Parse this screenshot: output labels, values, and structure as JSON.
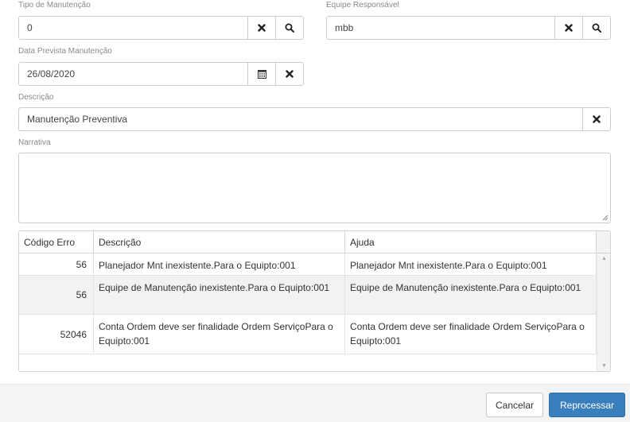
{
  "tipo_manutencao": {
    "label": "Tipo de Manutenção",
    "value": "0"
  },
  "equipe_responsavel": {
    "label": "Equipe Responsável",
    "value": "mbb"
  },
  "data_prevista": {
    "label": "Data Prevista Manutenção",
    "value": "26/08/2020"
  },
  "descricao": {
    "label": "Descrição",
    "value": "Manutenção Preventiva"
  },
  "narrativa": {
    "label": "Narrativa",
    "value": ""
  },
  "grid": {
    "columns": [
      "Código Erro",
      "Descrição",
      "Ajuda"
    ],
    "rows": [
      {
        "codigo": "56",
        "descricao": "Planejador Mnt inexistente.Para o Equipto:001",
        "ajuda": "Planejador Mnt inexistente.Para o Equipto:001"
      },
      {
        "codigo": "56",
        "descricao": "Equipe de Manutenção inexistente.Para o Equipto:001",
        "ajuda": "Equipe de Manutenção inexistente.Para o Equipto:001"
      },
      {
        "codigo": "52046",
        "descricao": "Conta Ordem deve ser finalidade Ordem ServiçoPara o Equipto:001",
        "ajuda": "Conta Ordem deve ser finalidade Ordem ServiçoPara o Equipto:001"
      }
    ]
  },
  "footer": {
    "cancel_label": "Cancelar",
    "reprocess_label": "Reprocessar"
  },
  "colors": {
    "primary": "#3a7fbd",
    "border": "#cccccc",
    "label": "#8a8a8a",
    "alt_row": "#f2f2f2"
  },
  "icons": {
    "clear": "times-icon",
    "search": "search-icon",
    "calendar": "calendar-icon"
  }
}
